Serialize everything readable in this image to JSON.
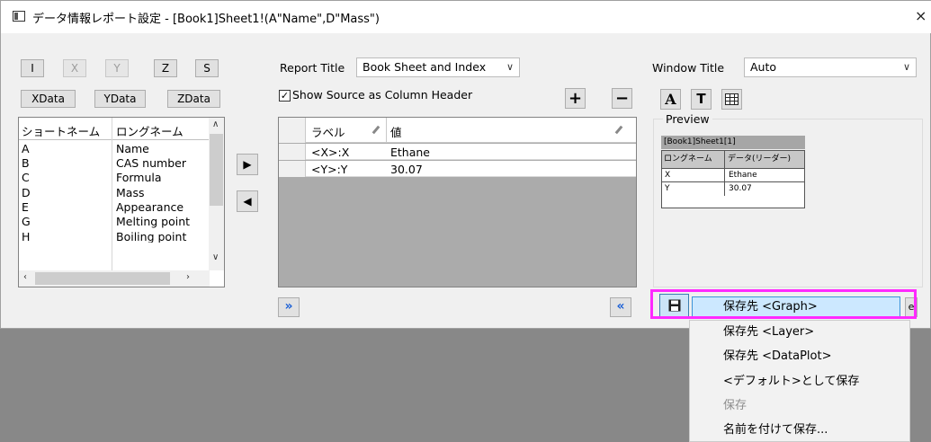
{
  "window": {
    "title": "データ情報レポート設定 - [Book1]Sheet1!(A\"Name\",D\"Mass\")",
    "close": "×"
  },
  "column_buttons": {
    "i": "I",
    "x": "X",
    "y": "Y",
    "z": "Z",
    "s": "S",
    "xdata": "XData",
    "ydata": "YData",
    "zdata": "ZData"
  },
  "left_list": {
    "headers": [
      "ショートネーム",
      "ロングネーム"
    ],
    "rows": [
      {
        "short": "A",
        "long": "Name"
      },
      {
        "short": "B",
        "long": "CAS number"
      },
      {
        "short": "C",
        "long": "Formula"
      },
      {
        "short": "D",
        "long": "Mass"
      },
      {
        "short": "E",
        "long": "Appearance"
      },
      {
        "short": "G",
        "long": "Melting point"
      },
      {
        "short": "H",
        "long": "Boiling point"
      }
    ]
  },
  "report": {
    "title_label": "Report Title",
    "title_value": "Book Sheet and Index",
    "show_source_label": "Show Source as Column Header",
    "show_source_checked": "✓"
  },
  "mid_table": {
    "headers": [
      "ラベル",
      "値"
    ],
    "rows": [
      {
        "label": "<X>:X",
        "value": "Ethane"
      },
      {
        "label": "<Y>:Y",
        "value": "30.07"
      }
    ]
  },
  "window_title": {
    "label": "Window Title",
    "value": "Auto"
  },
  "preview": {
    "label": "Preview",
    "caption": "[Book1]Sheet1[1]",
    "col_headers": [
      "ロングネーム",
      "データ(リーダー)"
    ],
    "rows": [
      {
        "name": "X",
        "value": "Ethane"
      },
      {
        "name": "Y",
        "value": "30.07"
      }
    ]
  },
  "nav": {
    "expand": "»",
    "collapse": "«"
  },
  "save_dropdown": {
    "selected": "保存先 <Graph>",
    "items": [
      {
        "label": "保存先 <Layer>",
        "enabled": true
      },
      {
        "label": "保存先 <DataPlot>",
        "enabled": true
      },
      {
        "label": "<デフォルト>として保存",
        "enabled": true
      },
      {
        "label": "保存",
        "enabled": false
      },
      {
        "label": "名前を付けて保存...",
        "enabled": true
      }
    ]
  },
  "colors": {
    "accent": "#1a5fd6",
    "highlight": "#ff2aff",
    "menu_selected": "#cce8ff"
  }
}
